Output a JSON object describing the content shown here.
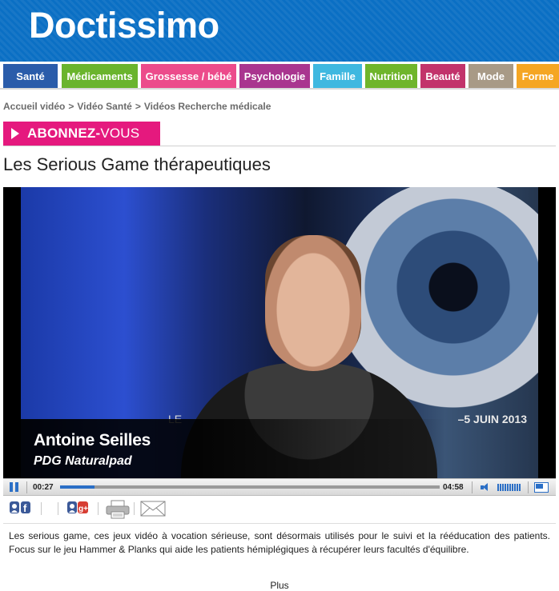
{
  "header": {
    "logo_text": "Doctissimo",
    "brand_color": "#0a6fc4"
  },
  "nav": {
    "items": [
      {
        "label": "Santé",
        "color": "#2a5caa"
      },
      {
        "label": "Médicaments",
        "color": "#6ab42d"
      },
      {
        "label": "Grossesse / bébé",
        "color": "#ec4b8b"
      },
      {
        "label": "Psychologie",
        "color": "#a9358f"
      },
      {
        "label": "Famille",
        "color": "#3fb8e0"
      },
      {
        "label": "Nutrition",
        "color": "#6fb52b"
      },
      {
        "label": "Beauté",
        "color": "#c2336b"
      },
      {
        "label": "Mode",
        "color": "#a89a86"
      },
      {
        "label": "Forme",
        "color": "#f5a623"
      }
    ]
  },
  "breadcrumb": {
    "items": [
      "Accueil vidéo",
      "Vidéo Santé",
      "Vidéos Recherche médicale"
    ],
    "separator": ">"
  },
  "subscribe": {
    "label_bold": "ABONNEZ-",
    "label_regular": "VOUS",
    "color": "#e5197e"
  },
  "page": {
    "title": "Les Serious Game thérapeutiques"
  },
  "video": {
    "caption_name": "Antoine Seilles",
    "caption_role": "PDG Naturalpad",
    "background_text_left": "LE",
    "background_text_date": "–5 JUIN 2013",
    "current_time": "00:27",
    "total_time": "04:58",
    "progress_fraction": 0.09,
    "state": "playing"
  },
  "share": {
    "icons": [
      "facebook-share-icon",
      "google-plus-share-icon",
      "print-icon",
      "email-icon"
    ]
  },
  "description": {
    "text": "Les serious game, ces jeux vidéo à vocation sérieuse, sont  désormais utilisés pour le suivi et la rééducation des patients. Focus sur le jeu Hammer & Planks qui aide les patients hémiplégiques à  récupérer leurs facultés d'équilibre.",
    "more_label": "Plus"
  }
}
